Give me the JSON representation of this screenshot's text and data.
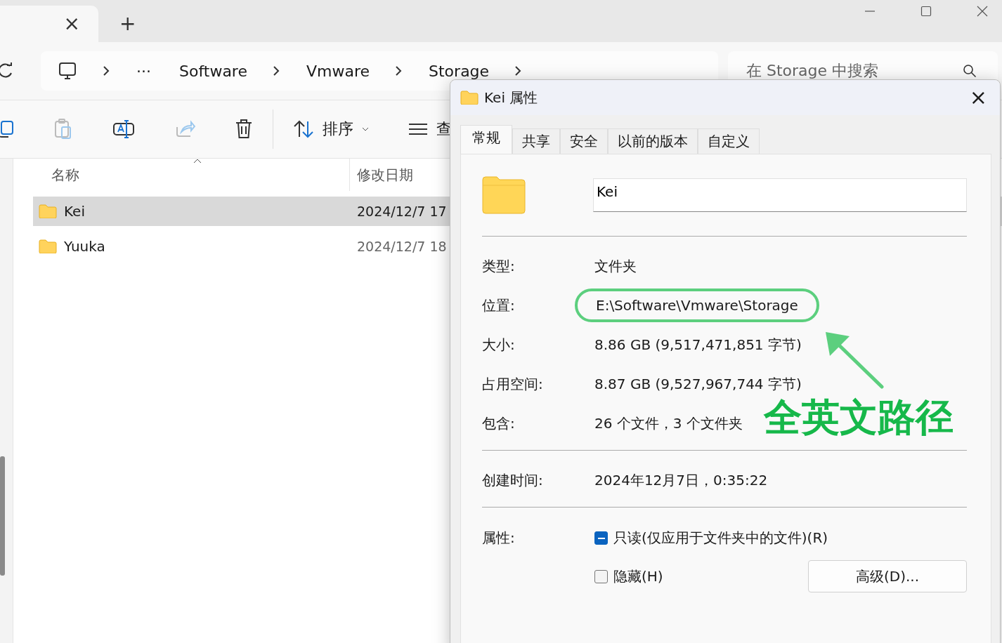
{
  "tab": {
    "close": "×",
    "new": "+"
  },
  "breadcrumb": {
    "more": "···",
    "items": [
      "Software",
      "Vmware",
      "Storage"
    ]
  },
  "search": {
    "placeholder": "在 Storage 中搜索"
  },
  "toolbar": {
    "sort": "排序",
    "view": "查"
  },
  "columns": [
    "名称",
    "修改日期"
  ],
  "rows": [
    {
      "name": "Kei",
      "modified": "2024/12/7 17",
      "selected": true
    },
    {
      "name": "Yuuka",
      "modified": "2024/12/7 18",
      "selected": false
    }
  ],
  "dialog": {
    "title": "Kei 属性",
    "close": "×",
    "tabs": [
      {
        "label": "常规",
        "selected": true
      },
      {
        "label": "共享",
        "selected": false
      },
      {
        "label": "安全",
        "selected": false
      },
      {
        "label": "以前的版本",
        "selected": false
      },
      {
        "label": "自定义",
        "selected": false
      }
    ],
    "name_value": "Kei",
    "groups": [
      [
        {
          "label": "类型:",
          "value": "文件夹",
          "highlighted": false
        },
        {
          "label": "位置:",
          "value": "E:\\Software\\Vmware\\Storage",
          "highlighted": true
        },
        {
          "label": "大小:",
          "value": "8.86 GB (9,517,471,851 字节)",
          "highlighted": false
        },
        {
          "label": "占用空间:",
          "value": "8.87 GB (9,527,967,744 字节)",
          "highlighted": false
        },
        {
          "label": "包含:",
          "value": "26 个文件，3 个文件夹",
          "highlighted": false
        }
      ],
      [
        {
          "label": "创建时间:",
          "value": "2024年12月7日，0:35:22",
          "highlighted": false
        }
      ]
    ],
    "attributes_label": "属性:",
    "checkboxes": [
      {
        "kind": "mixed",
        "label": "只读(仅应用于文件夹中的文件)(R)",
        "checked": true
      },
      {
        "kind": "checkbox",
        "label": "隐藏(H)",
        "checked": false
      }
    ],
    "advanced_button": "高级(D)..."
  },
  "annotation": {
    "text": "全英文路径"
  }
}
